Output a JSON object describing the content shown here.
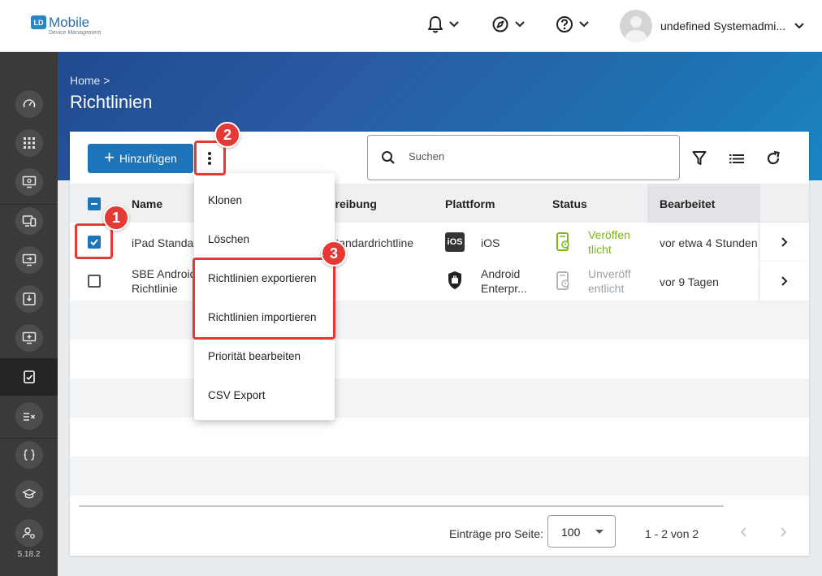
{
  "app": {
    "logo_badge": "LD",
    "logo_main": "Mobile",
    "logo_sub": "Device Management",
    "user_name": "undefined Systemadmi...",
    "version": "5.18.2"
  },
  "header": {
    "breadcrumb": "Home >",
    "title": "Richtlinien"
  },
  "toolbar": {
    "add_label": "Hinzufügen",
    "search_placeholder": "Suchen"
  },
  "table": {
    "columns": {
      "name": "Name",
      "description": "hreibung",
      "platform": "Plattform",
      "status": "Status",
      "edited": "Bearbeitet"
    },
    "rows": [
      {
        "name_line1": "iPad Standar",
        "name_line2": "",
        "description": "Standardrichtline",
        "platform_line1": "iOS",
        "platform_line2": "",
        "platform_icon_text": "iOS",
        "status_line1": "Veröffen",
        "status_line2": "tlicht",
        "edited": "vor etwa 4 Stunden"
      },
      {
        "name_line1": "SBE Android",
        "name_line2": "Richtlinie",
        "description": "",
        "platform_line1": "Android",
        "platform_line2": "Enterpr...",
        "platform_icon_text": "",
        "status_line1": "Unveröff",
        "status_line2": "entlicht",
        "edited": "vor 9 Tagen"
      }
    ]
  },
  "menu": {
    "items": [
      "Klonen",
      "Löschen",
      "Richtlinien exportieren",
      "Richtlinien importieren",
      "Priorität bearbeiten",
      "CSV Export"
    ]
  },
  "footer": {
    "per_page_label": "Einträge pro Seite:",
    "per_page_value": "100",
    "range": "1 - 2 von 2"
  },
  "annotations": [
    "1",
    "2",
    "3"
  ],
  "colors": {
    "primary": "#1c74b9",
    "highlight": "#e53935",
    "published": "#7cb518",
    "unpublished": "#9aa0a6",
    "sidebar": "#3a3a3a"
  }
}
